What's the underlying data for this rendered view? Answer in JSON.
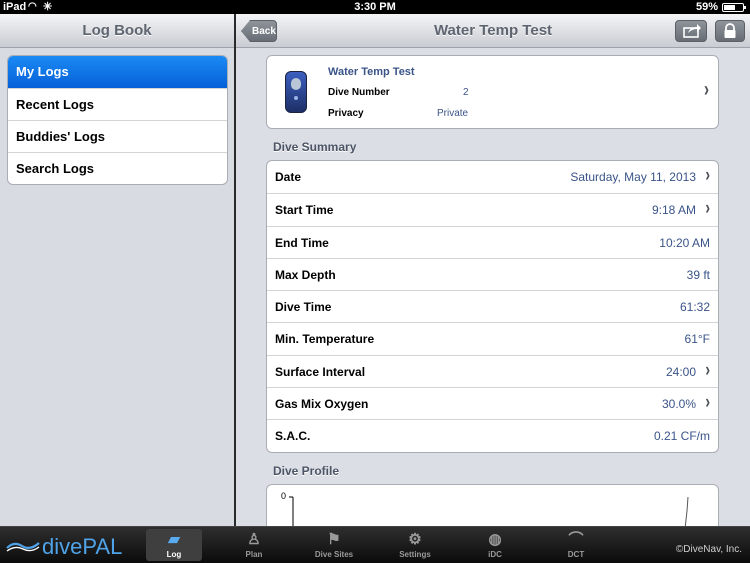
{
  "status_bar": {
    "carrier": "iPad",
    "time": "3:30 PM",
    "battery": "59%",
    "battery_level": 0.59
  },
  "left_nav": {
    "title": "Log Book",
    "items": [
      {
        "label": "My Logs",
        "selected": true
      },
      {
        "label": "Recent Logs",
        "selected": false
      },
      {
        "label": "Buddies' Logs",
        "selected": false
      },
      {
        "label": "Search Logs",
        "selected": false
      }
    ]
  },
  "right_nav": {
    "title": "Water Temp Test",
    "back_label": "Back",
    "share_icon": "share-icon",
    "lock_icon": "lock-icon"
  },
  "dive_header": {
    "name": "Water Temp Test",
    "dive_number_label": "Dive Number",
    "dive_number": "2",
    "privacy_label": "Privacy",
    "privacy": "Private"
  },
  "summary": {
    "title": "Dive Summary",
    "rows": [
      {
        "label": "Date",
        "value": "Saturday, May 11, 2013",
        "chevron": true
      },
      {
        "label": "Start Time",
        "value": "9:18 AM",
        "chevron": true
      },
      {
        "label": "End Time",
        "value": "10:20 AM",
        "chevron": false
      },
      {
        "label": "Max Depth",
        "value": "39 ft",
        "chevron": false
      },
      {
        "label": "Dive Time",
        "value": "61:32",
        "chevron": false
      },
      {
        "label": "Min. Temperature",
        "value": "61°F",
        "chevron": false
      },
      {
        "label": "Surface Interval",
        "value": "24:00",
        "chevron": true
      },
      {
        "label": "Gas Mix Oxygen",
        "value": "30.0%",
        "chevron": true
      },
      {
        "label": "S.A.C.",
        "value": "0.21 CF/m",
        "chevron": false
      }
    ]
  },
  "profile": {
    "title": "Dive Profile",
    "y_tick": "0"
  },
  "tab_bar": {
    "logo": "divePAL",
    "tabs": [
      {
        "label": "Log",
        "icon": "log-icon",
        "active": true
      },
      {
        "label": "Plan",
        "icon": "plan-icon",
        "active": false
      },
      {
        "label": "Dive Sites",
        "icon": "dive-sites-icon",
        "active": false
      },
      {
        "label": "Settings",
        "icon": "settings-icon",
        "active": false
      },
      {
        "label": "iDC",
        "icon": "idc-icon",
        "active": false
      },
      {
        "label": "DCT",
        "icon": "dct-icon",
        "active": false
      }
    ],
    "copyright": "©DiveNav, Inc."
  },
  "colors": {
    "accent": "#0a6de0",
    "value_text": "#3a5488"
  }
}
